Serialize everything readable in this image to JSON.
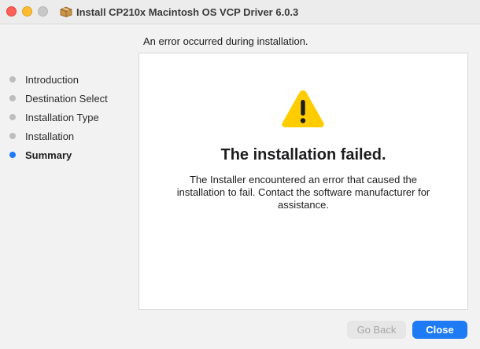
{
  "window": {
    "title": "Install CP210x Macintosh OS VCP Driver 6.0.3",
    "title_icon": "package-icon"
  },
  "heading": "An error occurred during installation.",
  "sidebar": {
    "steps": [
      {
        "label": "Introduction",
        "active": false
      },
      {
        "label": "Destination Select",
        "active": false
      },
      {
        "label": "Installation Type",
        "active": false
      },
      {
        "label": "Installation",
        "active": false
      },
      {
        "label": "Summary",
        "active": true
      }
    ]
  },
  "content": {
    "icon": "warning-icon",
    "title": "The installation failed.",
    "message": "The Installer encountered an error that caused the installation to fail. Contact the software manufacturer for assistance."
  },
  "buttons": {
    "back_label": "Go Back",
    "back_enabled": false,
    "close_label": "Close"
  },
  "colors": {
    "accent": "#1e7bf3",
    "warning": "#ffcc00",
    "traffic_close": "#fe5f57",
    "traffic_minimize": "#febc2e"
  }
}
